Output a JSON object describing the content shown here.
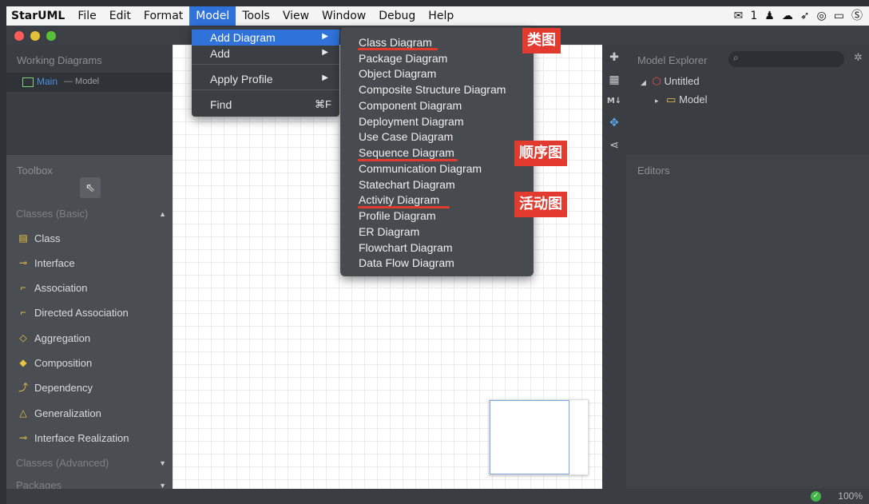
{
  "menubar": {
    "app": "StarUML",
    "items": [
      "File",
      "Edit",
      "Format",
      "Model",
      "Tools",
      "View",
      "Window",
      "Debug",
      "Help"
    ],
    "active_index": 3,
    "tray_badge": "1"
  },
  "left_panel": {
    "working_title": "Working Diagrams",
    "diagram_name": "Main",
    "diagram_suffix": "— Model",
    "toolbox_title": "Toolbox",
    "sections": [
      {
        "label": "Classes (Basic)",
        "arrow": "▲"
      },
      {
        "label": "Classes (Advanced)",
        "arrow": "▼"
      },
      {
        "label": "Packages",
        "arrow": "▼"
      }
    ],
    "tools": [
      {
        "label": "Class",
        "icon": "class-icon",
        "glyph": "▤"
      },
      {
        "label": "Interface",
        "icon": "interface-icon",
        "glyph": "⊸"
      },
      {
        "label": "Association",
        "icon": "association-icon",
        "glyph": "⌐"
      },
      {
        "label": "Directed Association",
        "icon": "directed-association-icon",
        "glyph": "⌐"
      },
      {
        "label": "Aggregation",
        "icon": "aggregation-icon",
        "glyph": "◇"
      },
      {
        "label": "Composition",
        "icon": "composition-icon",
        "glyph": "◆"
      },
      {
        "label": "Dependency",
        "icon": "dependency-icon",
        "glyph": "⤴"
      },
      {
        "label": "Generalization",
        "icon": "generalization-icon",
        "glyph": "△"
      },
      {
        "label": "Interface Realization",
        "icon": "interface-realization-icon",
        "glyph": "⊸"
      }
    ]
  },
  "model_menu": {
    "items": [
      {
        "label": "Add Diagram",
        "submenu": "▶"
      },
      {
        "label": "Add",
        "submenu": "▶"
      },
      {
        "label": "Apply Profile",
        "submenu": "▶"
      },
      {
        "label": "Find",
        "shortcut": "⌘F"
      }
    ]
  },
  "add_diagram_menu": {
    "items": [
      "Class Diagram",
      "Package Diagram",
      "Object Diagram",
      "Composite Structure Diagram",
      "Component Diagram",
      "Deployment Diagram",
      "Use Case Diagram",
      "Sequence Diagram",
      "Communication Diagram",
      "Statechart Diagram",
      "Activity Diagram",
      "Profile Diagram",
      "ER Diagram",
      "Flowchart Diagram",
      "Data Flow Diagram"
    ]
  },
  "annotations": {
    "class_diagram": "类图",
    "sequence_diagram": "顺序图",
    "activity_diagram": "活动图"
  },
  "right_panel": {
    "explorer_title": "Model Explorer",
    "search_placeholder": "",
    "tree_root": "Untitled",
    "tree_child": "Model",
    "editors_title": "Editors"
  },
  "status": {
    "zoom": "100%"
  },
  "colors": {
    "accent": "#2f72d9",
    "annotation_red": "#e23a2f",
    "tool_icon_yellow": "#e8c445"
  }
}
